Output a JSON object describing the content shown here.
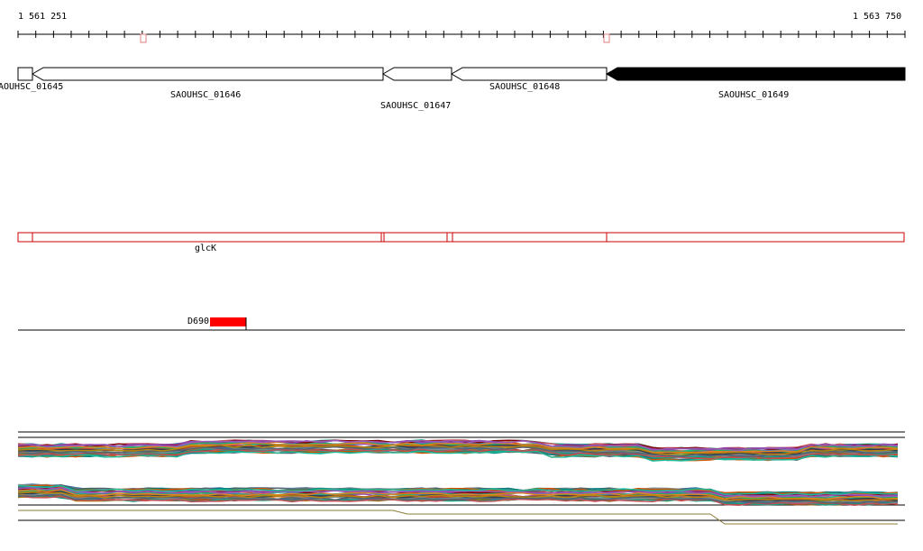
{
  "coordinates": {
    "start_label": "1 561 251",
    "end_label": "1 563 750"
  },
  "genes": [
    {
      "id": "g1",
      "label": "AOUHSC_01645",
      "strand": "minus",
      "filled": false
    },
    {
      "id": "g2",
      "label": "SAOUHSC_01646",
      "strand": "minus",
      "filled": false
    },
    {
      "id": "g3",
      "label": "SAOUHSC_01647",
      "strand": "minus",
      "filled": false
    },
    {
      "id": "g4",
      "label": "SAOUHSC_01648",
      "strand": "minus",
      "filled": false
    },
    {
      "id": "g5",
      "label": "SAOUHSC_01649",
      "strand": "minus",
      "filled": true
    }
  ],
  "annotation_track": {
    "label": "glcK",
    "color": "#cc0000"
  },
  "feature_track": {
    "label": "D690",
    "color": "#ff0000"
  },
  "colors": {
    "axis": "#000000",
    "ruler_marker": "#e08080",
    "gene_outline": "#000000",
    "gene_fill_highlight": "#000000"
  }
}
